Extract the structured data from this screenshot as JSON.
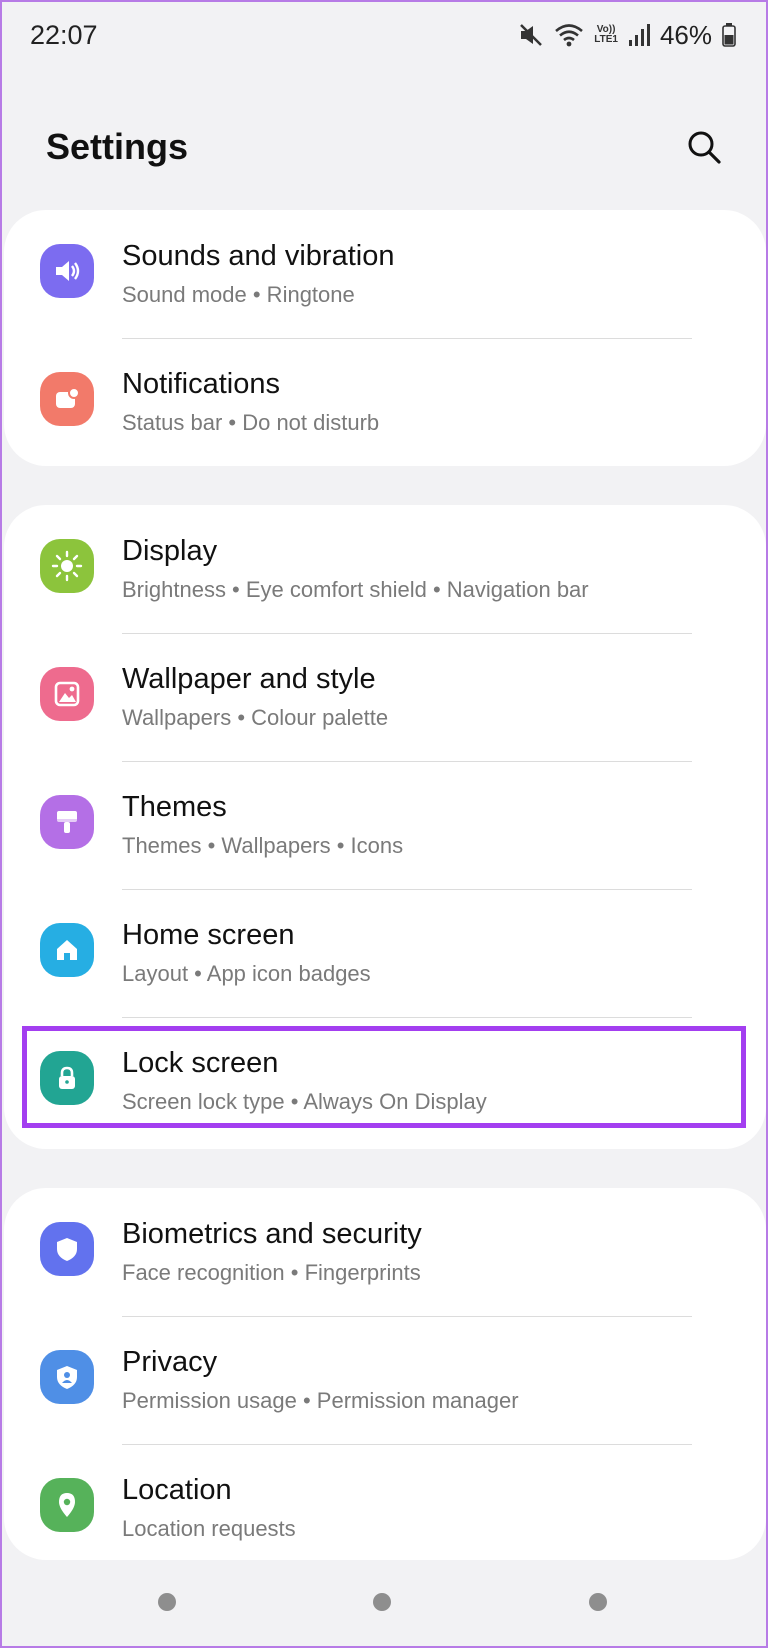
{
  "status_bar": {
    "time": "22:07",
    "lte_top": "Vo))",
    "lte_bottom": "LTE1",
    "battery": "46%",
    "icons": [
      "mute-vibrate-icon",
      "wifi-icon",
      "volte-icon",
      "signal-icon",
      "battery-icon"
    ]
  },
  "header": {
    "title": "Settings",
    "search_icon": "search-icon"
  },
  "groups": [
    {
      "items": [
        {
          "title": "Sounds and vibration",
          "subtitle": "Sound mode  •  Ringtone",
          "icon": "speaker-icon",
          "color": "#7c6cf0"
        },
        {
          "title": "Notifications",
          "subtitle": "Status bar  •  Do not disturb",
          "icon": "notification-icon",
          "color": "#f27a6a"
        }
      ]
    },
    {
      "items": [
        {
          "title": "Display",
          "subtitle": "Brightness  •  Eye comfort shield  •  Navigation bar",
          "icon": "sun-icon",
          "color": "#8cc43c"
        },
        {
          "title": "Wallpaper and style",
          "subtitle": "Wallpapers  •  Colour palette",
          "icon": "image-icon",
          "color": "#ee6b8e"
        },
        {
          "title": "Themes",
          "subtitle": "Themes  •  Wallpapers  •  Icons",
          "icon": "paintbrush-icon",
          "color": "#b46fe6"
        },
        {
          "title": "Home screen",
          "subtitle": "Layout  •  App icon badges",
          "icon": "home-icon",
          "color": "#26aee3"
        },
        {
          "title": "Lock screen",
          "subtitle": "Screen lock type  •  Always On Display",
          "icon": "lock-icon",
          "color": "#22a593"
        }
      ]
    },
    {
      "items": [
        {
          "title": "Biometrics and security",
          "subtitle": "Face recognition  •  Fingerprints",
          "icon": "shield-icon",
          "color": "#6272ee"
        },
        {
          "title": "Privacy",
          "subtitle": "Permission usage  •  Permission manager",
          "icon": "privacy-icon",
          "color": "#4f8fe6"
        },
        {
          "title": "Location",
          "subtitle": "Location requests",
          "icon": "location-pin-icon",
          "color": "#56b25a"
        }
      ]
    }
  ],
  "highlight_color": "#a33ef0"
}
